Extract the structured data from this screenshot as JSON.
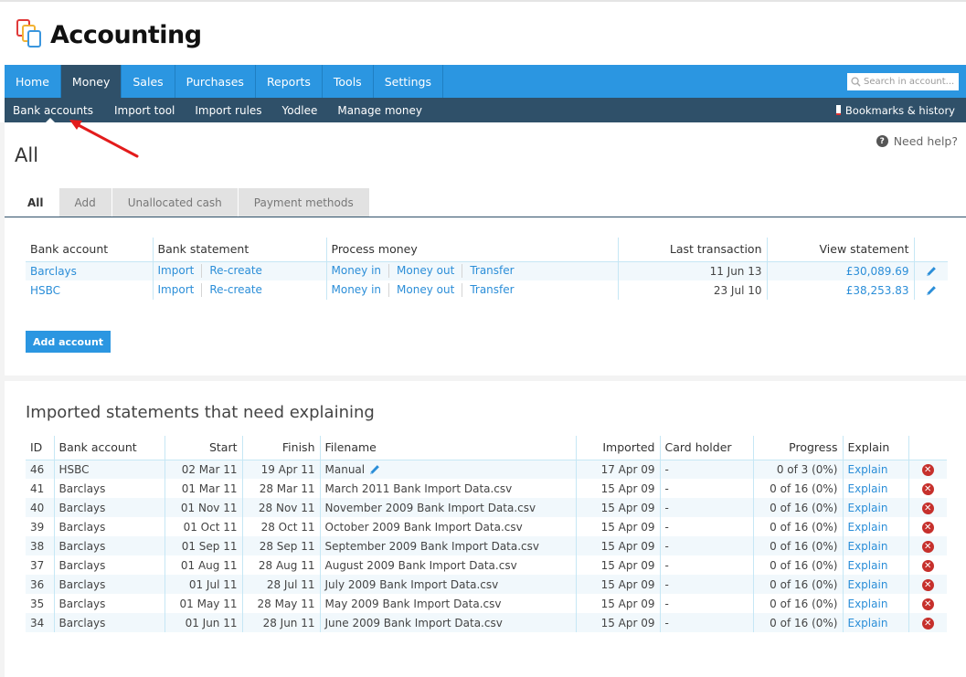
{
  "app": {
    "title": "Accounting"
  },
  "main_nav": {
    "tabs": [
      {
        "label": "Home",
        "active": false
      },
      {
        "label": "Money",
        "active": true
      },
      {
        "label": "Sales",
        "active": false
      },
      {
        "label": "Purchases",
        "active": false
      },
      {
        "label": "Reports",
        "active": false
      },
      {
        "label": "Tools",
        "active": false
      },
      {
        "label": "Settings",
        "active": false
      }
    ],
    "search": {
      "placeholder": "Search in account...",
      "icon": "search-icon"
    }
  },
  "sub_nav": {
    "items": [
      {
        "label": "Bank accounts",
        "active": true
      },
      {
        "label": "Import tool",
        "active": false
      },
      {
        "label": "Import rules",
        "active": false
      },
      {
        "label": "Yodlee",
        "active": false
      },
      {
        "label": "Manage money",
        "active": false
      }
    ],
    "bookmarks_label": "Bookmarks & history"
  },
  "help": {
    "label": "Need help?",
    "icon": "question-icon"
  },
  "page": {
    "title": "All",
    "tabs": [
      {
        "label": "All",
        "active": true
      },
      {
        "label": "Add",
        "active": false
      },
      {
        "label": "Unallocated cash",
        "active": false
      },
      {
        "label": "Payment methods",
        "active": false
      }
    ]
  },
  "bank_accounts": {
    "headers": [
      "Bank account",
      "Bank statement",
      "Process money",
      "Last transaction",
      "View statement"
    ],
    "rows": [
      {
        "name": "Barclays",
        "import": "Import",
        "recreate": "Re-create",
        "money_in": "Money in",
        "money_out": "Money out",
        "transfer": "Transfer",
        "last_transaction": "11 Jun 13",
        "balance": "£30,089.69"
      },
      {
        "name": "HSBC",
        "import": "Import",
        "recreate": "Re-create",
        "money_in": "Money in",
        "money_out": "Money out",
        "transfer": "Transfer",
        "last_transaction": "23 Jul 10",
        "balance": "£38,253.83"
      }
    ],
    "add_button": "Add account"
  },
  "statements": {
    "title": "Imported statements that need explaining",
    "headers": [
      "ID",
      "Bank account",
      "Start",
      "Finish",
      "Filename",
      "Imported",
      "Card holder",
      "Progress",
      "Explain"
    ],
    "rows": [
      {
        "id": "46",
        "bank": "HSBC",
        "start": "02 Mar 11",
        "finish": "19 Apr 11",
        "filename": "Manual",
        "editable": true,
        "imported": "17 Apr 09",
        "card_holder": "-",
        "progress": "0 of 3 (0%)",
        "explain": "Explain"
      },
      {
        "id": "41",
        "bank": "Barclays",
        "start": "01 Mar 11",
        "finish": "28 Mar 11",
        "filename": "March 2011 Bank Import Data.csv",
        "imported": "15 Apr 09",
        "card_holder": "-",
        "progress": "0 of 16 (0%)",
        "explain": "Explain"
      },
      {
        "id": "40",
        "bank": "Barclays",
        "start": "01 Nov 11",
        "finish": "28 Nov 11",
        "filename": "November 2009 Bank Import Data.csv",
        "imported": "15 Apr 09",
        "card_holder": "-",
        "progress": "0 of 16 (0%)",
        "explain": "Explain"
      },
      {
        "id": "39",
        "bank": "Barclays",
        "start": "01 Oct 11",
        "finish": "28 Oct 11",
        "filename": "October 2009 Bank Import Data.csv",
        "imported": "15 Apr 09",
        "card_holder": "-",
        "progress": "0 of 16 (0%)",
        "explain": "Explain"
      },
      {
        "id": "38",
        "bank": "Barclays",
        "start": "01 Sep 11",
        "finish": "28 Sep 11",
        "filename": "September 2009 Bank Import Data.csv",
        "imported": "15 Apr 09",
        "card_holder": "-",
        "progress": "0 of 16 (0%)",
        "explain": "Explain"
      },
      {
        "id": "37",
        "bank": "Barclays",
        "start": "01 Aug 11",
        "finish": "28 Aug 11",
        "filename": "August 2009 Bank Import Data.csv",
        "imported": "15 Apr 09",
        "card_holder": "-",
        "progress": "0 of 16 (0%)",
        "explain": "Explain"
      },
      {
        "id": "36",
        "bank": "Barclays",
        "start": "01 Jul 11",
        "finish": "28 Jul 11",
        "filename": "July 2009 Bank Import Data.csv",
        "imported": "15 Apr 09",
        "card_holder": "-",
        "progress": "0 of 16 (0%)",
        "explain": "Explain"
      },
      {
        "id": "35",
        "bank": "Barclays",
        "start": "01 May 11",
        "finish": "28 May 11",
        "filename": "May 2009 Bank Import Data.csv",
        "imported": "15 Apr 09",
        "card_holder": "-",
        "progress": "0 of 16 (0%)",
        "explain": "Explain"
      },
      {
        "id": "34",
        "bank": "Barclays",
        "start": "01 Jun 11",
        "finish": "28 Jun 11",
        "filename": "June 2009 Bank Import Data.csv",
        "imported": "15 Apr 09",
        "card_holder": "-",
        "progress": "0 of 16 (0%)",
        "explain": "Explain"
      }
    ]
  },
  "colors": {
    "primary_blue": "#2b96e1",
    "dark_nav": "#2f5069",
    "link": "#2b8ed8",
    "delete_red": "#c6302c",
    "annotation_arrow": "#e31b1b"
  }
}
